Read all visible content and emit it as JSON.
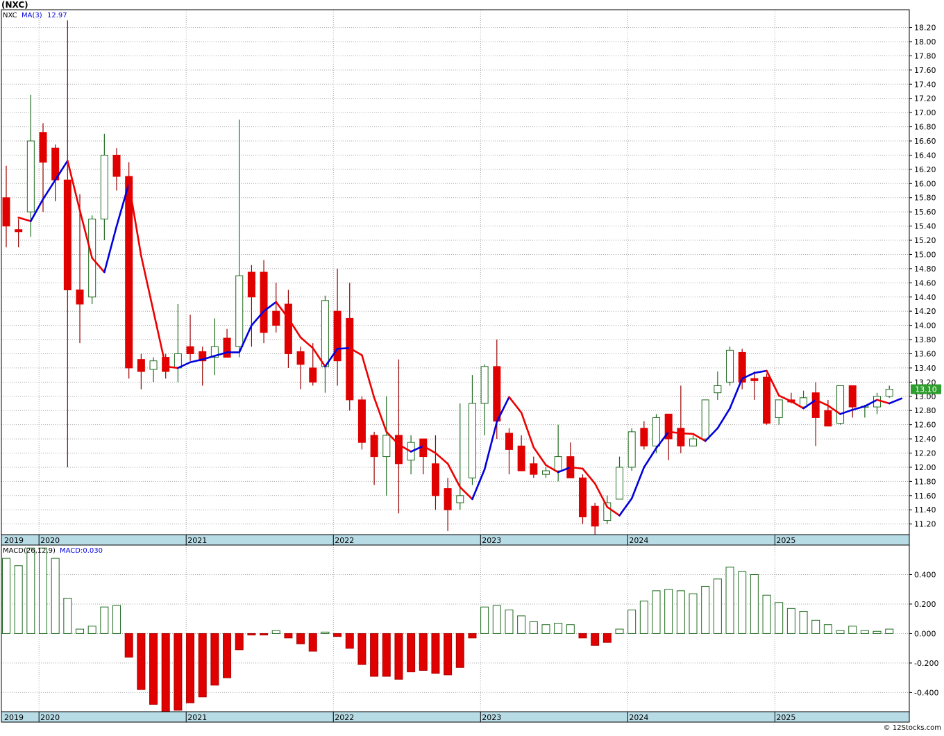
{
  "title": "(NXC)",
  "watermark": "© 12Stocks.com",
  "colors": {
    "up": "#1f6b1f",
    "down": "#e00000",
    "ma_blue": "#0000dd",
    "ma_red": "#ee0000",
    "grid": "#a8a8a8",
    "timebar": "#b8dce6",
    "last_box": "#2e9e2e"
  },
  "price_panel": {
    "legend": {
      "symbol": "NXC",
      "ma_label": "MA(3)",
      "ma_value": "12.97"
    },
    "last_price": "13.10",
    "ylim": [
      11.05,
      18.45
    ],
    "yticks": [
      "18.20",
      "18.00",
      "17.80",
      "17.60",
      "17.40",
      "17.20",
      "17.00",
      "16.80",
      "16.60",
      "16.40",
      "16.20",
      "16.00",
      "15.80",
      "15.60",
      "15.40",
      "15.20",
      "15.00",
      "14.80",
      "14.60",
      "14.40",
      "14.20",
      "14.00",
      "13.80",
      "13.60",
      "13.40",
      "13.20",
      "13.00",
      "12.80",
      "12.60",
      "12.40",
      "12.20",
      "12.00",
      "11.80",
      "11.60",
      "11.40",
      "11.20"
    ]
  },
  "macd_panel": {
    "legend": {
      "label": "MACD(26,12,9)",
      "value_label": "MACD:0.030"
    },
    "ylim": [
      -0.53,
      0.6
    ],
    "yticks": [
      "0.400",
      "0.200",
      "0.000",
      "-0.200",
      "-0.400"
    ]
  },
  "x_axis": {
    "years": [
      {
        "label": "2019",
        "bar": 0
      },
      {
        "label": "2020",
        "bar": 3
      },
      {
        "label": "2021",
        "bar": 15
      },
      {
        "label": "2022",
        "bar": 27
      },
      {
        "label": "2023",
        "bar": 39
      },
      {
        "label": "2024",
        "bar": 51
      },
      {
        "label": "2025",
        "bar": 63
      }
    ]
  },
  "chart_data": [
    {
      "type": "candlestick",
      "title": "(NXC)",
      "series_note": "monthly OHLC with MA(3)",
      "bars": [
        {
          "o": 15.8,
          "h": 16.25,
          "l": 15.1,
          "c": 15.4
        },
        {
          "o": 15.35,
          "h": 15.5,
          "l": 15.1,
          "c": 15.32
        },
        {
          "o": 15.6,
          "h": 17.25,
          "l": 15.25,
          "c": 16.6
        },
        {
          "o": 16.72,
          "h": 16.85,
          "l": 15.6,
          "c": 16.3
        },
        {
          "o": 16.5,
          "h": 16.55,
          "l": 15.75,
          "c": 16.05
        },
        {
          "o": 16.05,
          "h": 18.3,
          "l": 12.0,
          "c": 14.5
        },
        {
          "o": 14.5,
          "h": 15.85,
          "l": 13.75,
          "c": 14.3
        },
        {
          "o": 14.4,
          "h": 15.55,
          "l": 14.3,
          "c": 15.5
        },
        {
          "o": 15.5,
          "h": 16.7,
          "l": 15.2,
          "c": 16.4
        },
        {
          "o": 16.4,
          "h": 16.5,
          "l": 15.9,
          "c": 16.1
        },
        {
          "o": 16.1,
          "h": 16.3,
          "l": 13.25,
          "c": 13.4
        },
        {
          "o": 13.52,
          "h": 13.6,
          "l": 13.1,
          "c": 13.35
        },
        {
          "o": 13.38,
          "h": 13.55,
          "l": 13.2,
          "c": 13.5
        },
        {
          "o": 13.55,
          "h": 13.6,
          "l": 13.25,
          "c": 13.35
        },
        {
          "o": 13.4,
          "h": 14.3,
          "l": 13.2,
          "c": 13.6
        },
        {
          "o": 13.7,
          "h": 14.15,
          "l": 13.5,
          "c": 13.6
        },
        {
          "o": 13.63,
          "h": 13.7,
          "l": 13.15,
          "c": 13.5
        },
        {
          "o": 13.55,
          "h": 14.1,
          "l": 13.3,
          "c": 13.7
        },
        {
          "o": 13.82,
          "h": 13.95,
          "l": 13.55,
          "c": 13.55
        },
        {
          "o": 13.7,
          "h": 16.9,
          "l": 13.55,
          "c": 14.7
        },
        {
          "o": 14.75,
          "h": 14.85,
          "l": 13.7,
          "c": 14.4
        },
        {
          "o": 14.75,
          "h": 14.92,
          "l": 13.75,
          "c": 13.9
        },
        {
          "o": 14.2,
          "h": 14.6,
          "l": 13.9,
          "c": 14.0
        },
        {
          "o": 14.3,
          "h": 14.5,
          "l": 13.4,
          "c": 13.6
        },
        {
          "o": 13.63,
          "h": 13.7,
          "l": 13.1,
          "c": 13.45
        },
        {
          "o": 13.4,
          "h": 13.75,
          "l": 13.15,
          "c": 13.2
        },
        {
          "o": 13.42,
          "h": 14.42,
          "l": 13.05,
          "c": 14.35
        },
        {
          "o": 14.2,
          "h": 14.8,
          "l": 13.15,
          "c": 13.5
        },
        {
          "o": 14.1,
          "h": 14.6,
          "l": 12.8,
          "c": 12.95
        },
        {
          "o": 12.95,
          "h": 13.0,
          "l": 12.25,
          "c": 12.35
        },
        {
          "o": 12.45,
          "h": 12.5,
          "l": 11.75,
          "c": 12.15
        },
        {
          "o": 12.15,
          "h": 13.0,
          "l": 11.6,
          "c": 12.45
        },
        {
          "o": 12.45,
          "h": 13.52,
          "l": 11.35,
          "c": 12.05
        },
        {
          "o": 12.1,
          "h": 12.45,
          "l": 11.9,
          "c": 12.35
        },
        {
          "o": 12.4,
          "h": 12.4,
          "l": 11.9,
          "c": 12.15
        },
        {
          "o": 12.05,
          "h": 12.45,
          "l": 11.4,
          "c": 11.6
        },
        {
          "o": 11.7,
          "h": 11.85,
          "l": 11.1,
          "c": 11.4
        },
        {
          "o": 11.5,
          "h": 12.9,
          "l": 11.4,
          "c": 11.6
        },
        {
          "o": 11.85,
          "h": 13.3,
          "l": 11.75,
          "c": 12.9
        },
        {
          "o": 12.9,
          "h": 13.45,
          "l": 12.45,
          "c": 13.42
        },
        {
          "o": 13.42,
          "h": 13.8,
          "l": 12.4,
          "c": 12.65
        },
        {
          "o": 12.48,
          "h": 12.55,
          "l": 11.9,
          "c": 12.25
        },
        {
          "o": 12.3,
          "h": 12.45,
          "l": 11.95,
          "c": 11.95
        },
        {
          "o": 12.05,
          "h": 12.15,
          "l": 11.85,
          "c": 11.9
        },
        {
          "o": 11.9,
          "h": 12.0,
          "l": 11.85,
          "c": 11.95
        },
        {
          "o": 11.95,
          "h": 12.6,
          "l": 11.8,
          "c": 12.15
        },
        {
          "o": 12.15,
          "h": 12.35,
          "l": 11.85,
          "c": 11.85
        },
        {
          "o": 11.85,
          "h": 11.9,
          "l": 11.2,
          "c": 11.3
        },
        {
          "o": 11.45,
          "h": 11.5,
          "l": 11.05,
          "c": 11.17
        },
        {
          "o": 11.25,
          "h": 11.6,
          "l": 11.2,
          "c": 11.5
        },
        {
          "o": 11.55,
          "h": 12.15,
          "l": 11.55,
          "c": 12.0
        },
        {
          "o": 12.0,
          "h": 12.55,
          "l": 11.95,
          "c": 12.5
        },
        {
          "o": 12.55,
          "h": 12.65,
          "l": 12.25,
          "c": 12.3
        },
        {
          "o": 12.3,
          "h": 12.75,
          "l": 12.2,
          "c": 12.7
        },
        {
          "o": 12.75,
          "h": 12.75,
          "l": 12.1,
          "c": 12.4
        },
        {
          "o": 12.55,
          "h": 13.15,
          "l": 12.2,
          "c": 12.3
        },
        {
          "o": 12.3,
          "h": 12.45,
          "l": 12.3,
          "c": 12.4
        },
        {
          "o": 12.4,
          "h": 12.95,
          "l": 12.4,
          "c": 12.95
        },
        {
          "o": 13.05,
          "h": 13.35,
          "l": 12.95,
          "c": 13.15
        },
        {
          "o": 13.2,
          "h": 13.7,
          "l": 13.15,
          "c": 13.65
        },
        {
          "o": 13.62,
          "h": 13.67,
          "l": 13.1,
          "c": 13.2
        },
        {
          "o": 13.25,
          "h": 13.35,
          "l": 12.95,
          "c": 13.22
        },
        {
          "o": 13.27,
          "h": 13.32,
          "l": 12.6,
          "c": 12.62
        },
        {
          "o": 12.7,
          "h": 12.95,
          "l": 12.6,
          "c": 12.95
        },
        {
          "o": 12.95,
          "h": 13.05,
          "l": 12.9,
          "c": 12.92
        },
        {
          "o": 12.85,
          "h": 13.08,
          "l": 12.85,
          "c": 12.98
        },
        {
          "o": 13.05,
          "h": 13.2,
          "l": 12.3,
          "c": 12.7
        },
        {
          "o": 12.8,
          "h": 12.95,
          "l": 12.58,
          "c": 12.58
        },
        {
          "o": 12.62,
          "h": 13.15,
          "l": 12.6,
          "c": 13.15
        },
        {
          "o": 13.15,
          "h": 13.15,
          "l": 12.7,
          "c": 12.85
        },
        {
          "o": 12.85,
          "h": 12.88,
          "l": 12.7,
          "c": 12.86
        },
        {
          "o": 12.85,
          "h": 13.05,
          "l": 12.75,
          "c": 13.0
        },
        {
          "o": 13.0,
          "h": 13.15,
          "l": 12.98,
          "c": 13.1
        }
      ],
      "ma3": [
        15.52,
        15.47,
        15.78,
        16.05,
        16.32,
        15.62,
        14.95,
        14.75,
        15.4,
        16.0,
        14.98,
        14.2,
        13.42,
        13.4,
        13.48,
        13.52,
        13.57,
        13.62,
        13.62,
        14.0,
        14.2,
        14.33,
        14.1,
        13.83,
        13.68,
        13.42,
        13.67,
        13.68,
        13.58,
        12.98,
        12.5,
        12.32,
        12.22,
        12.3,
        12.2,
        12.05,
        11.72,
        11.55,
        11.97,
        12.64,
        12.99,
        12.77,
        12.28,
        12.03,
        11.93,
        12.0,
        11.98,
        11.77,
        11.44,
        11.32,
        11.56,
        12.0,
        12.27,
        12.5,
        12.48,
        12.47,
        12.37,
        12.55,
        12.83,
        13.25,
        13.33,
        13.36,
        13.01,
        12.93,
        12.83,
        12.95,
        12.87,
        12.75,
        12.81,
        12.86,
        12.95,
        12.9,
        12.97
      ],
      "ma3_start": 1
    },
    {
      "type": "bar",
      "title": "MACD(26,12,9)",
      "values": [
        0.51,
        0.46,
        0.58,
        0.58,
        0.51,
        0.24,
        0.03,
        0.05,
        0.18,
        0.19,
        -0.16,
        -0.38,
        -0.48,
        -0.53,
        -0.52,
        -0.47,
        -0.43,
        -0.35,
        -0.3,
        -0.11,
        -0.01,
        -0.01,
        0.02,
        -0.03,
        -0.07,
        -0.12,
        0.01,
        -0.02,
        -0.1,
        -0.21,
        -0.29,
        -0.29,
        -0.31,
        -0.26,
        -0.25,
        -0.27,
        -0.28,
        -0.23,
        -0.03,
        0.18,
        0.19,
        0.16,
        0.12,
        0.08,
        0.06,
        0.07,
        0.06,
        -0.03,
        -0.08,
        -0.06,
        0.03,
        0.16,
        0.22,
        0.29,
        0.3,
        0.29,
        0.27,
        0.32,
        0.37,
        0.45,
        0.42,
        0.4,
        0.26,
        0.21,
        0.17,
        0.15,
        0.09,
        0.06,
        0.02,
        0.05,
        0.02,
        0.015,
        0.03
      ]
    }
  ]
}
